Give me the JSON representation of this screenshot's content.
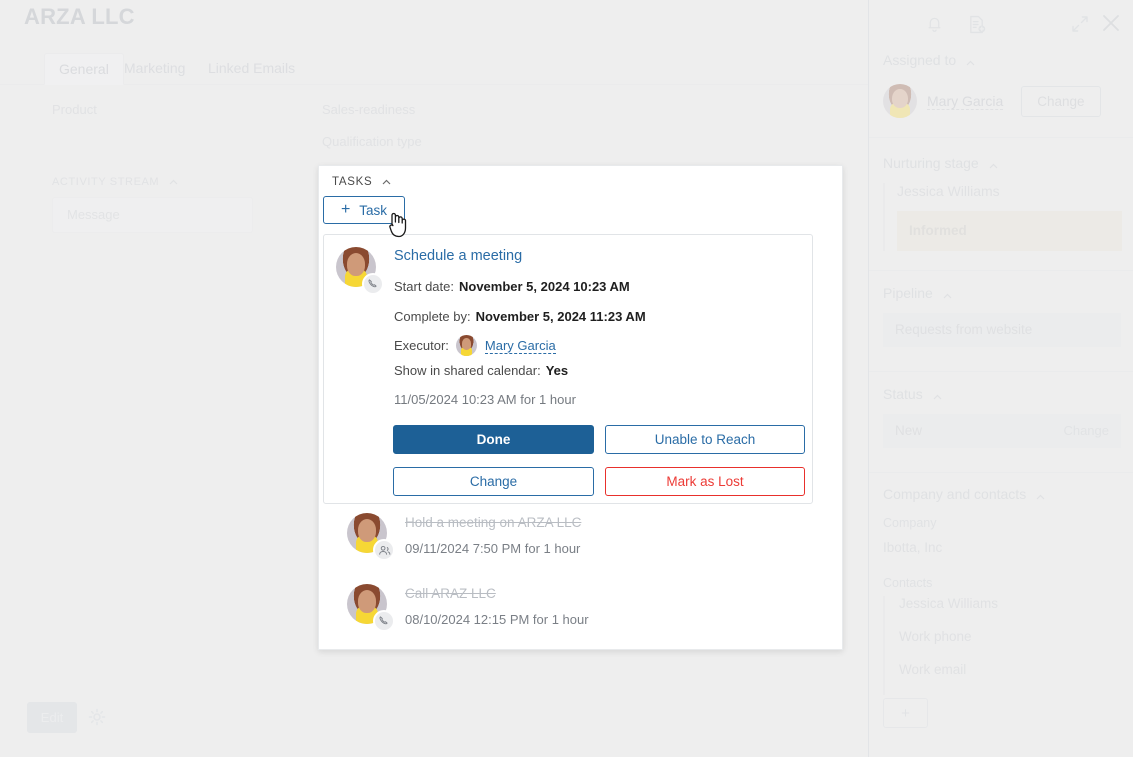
{
  "header": {
    "title": "ARZA LLC",
    "window_actions": [
      {
        "name": "bell-icon",
        "label": "Notifications"
      },
      {
        "name": "document-icon",
        "label": "Add document"
      },
      {
        "name": "expand-icon",
        "label": "Expand"
      },
      {
        "name": "close-icon",
        "label": "Close"
      }
    ]
  },
  "tabs": [
    {
      "label": "General",
      "active": true
    },
    {
      "label": "Marketing",
      "active": false
    },
    {
      "label": "Linked Emails",
      "active": false
    }
  ],
  "fields": {
    "product": "Product",
    "sales_readiness": "Sales-readiness",
    "qualification_type": "Qualification type"
  },
  "activity_stream": {
    "section_title": "ACTIVITY STREAM",
    "message_placeholder": "Message"
  },
  "footer": {
    "edit_label": "Edit",
    "gear_icon": "gear-icon"
  },
  "tasks_panel": {
    "header": "TASKS",
    "add_task_label": "Task",
    "add_task_plus": "+",
    "active_task": {
      "title": "Schedule a meeting",
      "type_icon": "phone-icon",
      "start_date_label": "Start date:",
      "start_date_value": "November 5, 2024 10:23 AM",
      "complete_by_label": "Complete by:",
      "complete_by_value": "November 5, 2024 11:23 AM",
      "executor_label": "Executor:",
      "executor_name": "Mary Garcia",
      "shared_calendar_label": "Show in shared calendar:",
      "shared_calendar_value": "Yes",
      "when": "11/05/2024 10:23 AM for 1 hour",
      "buttons": {
        "done": "Done",
        "unable_to_reach": "Unable to Reach",
        "change": "Change",
        "mark_as_lost": "Mark as Lost"
      }
    },
    "completed_tasks": [
      {
        "title": "Hold a meeting on ARZA LLC",
        "when": "09/11/2024 7:50 PM for 1 hour",
        "type_icon": "people-icon"
      },
      {
        "title": "Call ARAZ LLC",
        "when": "08/10/2024 12:15 PM for 1 hour",
        "type_icon": "phone-icon"
      }
    ]
  },
  "sidebar": {
    "assigned": {
      "title": "Assigned to",
      "name": "Mary Garcia",
      "change_label": "Change"
    },
    "nurturing": {
      "title": "Nurturing stage",
      "person": "Jessica Williams",
      "stage": "Informed"
    },
    "pipeline": {
      "title": "Pipeline",
      "value": "Requests from website"
    },
    "status": {
      "title": "Status",
      "value": "New",
      "change_label": "Change"
    },
    "company_and_contacts": {
      "title": "Company and contacts",
      "company_label": "Company",
      "company_value": "Ibotta, Inc",
      "contacts_label": "Contacts",
      "contacts": [
        {
          "label": "Jessica Williams"
        },
        {
          "label": "Work phone"
        },
        {
          "label": "Work email"
        }
      ],
      "add_label": "+"
    }
  },
  "colors": {
    "accent_blue": "#2a6ca6",
    "done_button": "#1d6096",
    "danger_red": "#ec3b36",
    "badge_beige": "#eae4d6",
    "page_bg": "#eeeeee"
  }
}
